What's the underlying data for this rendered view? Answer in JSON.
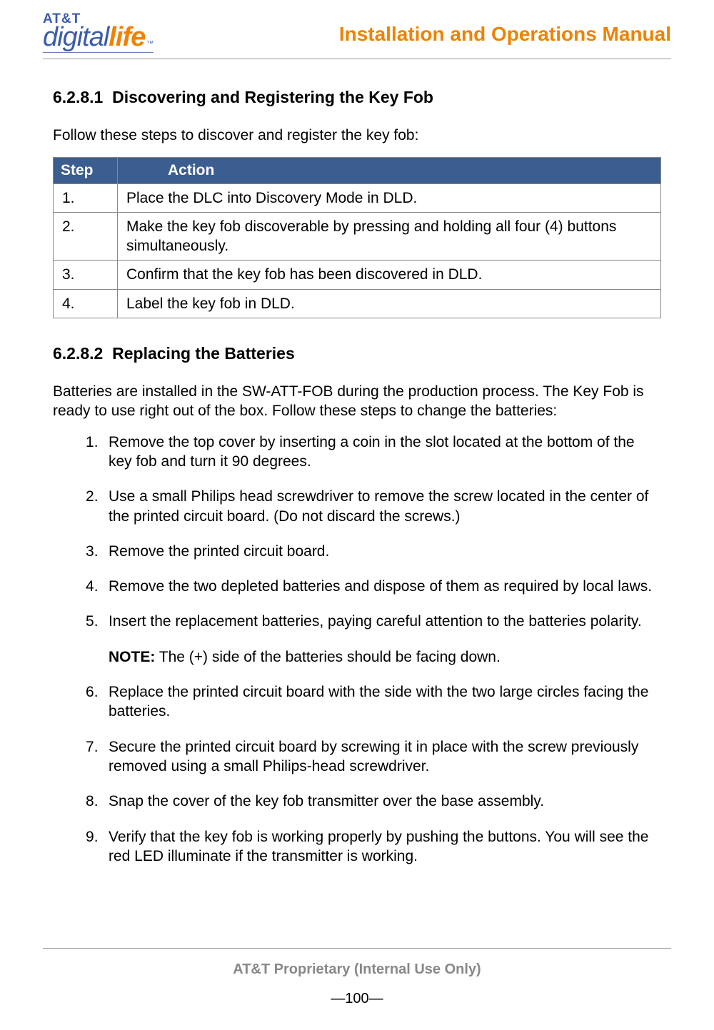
{
  "header": {
    "logo_top": "AT&T",
    "logo_left": "digital",
    "logo_right": "life",
    "logo_tm": "™",
    "doc_title": "Installation and Operations Manual"
  },
  "section1": {
    "number": "6.2.8.1",
    "title": "Discovering and Registering the Key Fob",
    "intro": "Follow these steps to discover and register the key fob:",
    "table": {
      "col_step": "Step",
      "col_action": "Action",
      "rows": [
        {
          "step": "1.",
          "action": "Place the DLC into Discovery Mode in DLD."
        },
        {
          "step": "2.",
          "action": "Make the key fob discoverable by pressing and holding all four (4) buttons simultaneously."
        },
        {
          "step": "3.",
          "action": "Confirm that the key fob has been discovered in DLD."
        },
        {
          "step": "4.",
          "action": "Label the key fob in DLD."
        }
      ]
    }
  },
  "section2": {
    "number": "6.2.8.2",
    "title": "Replacing the Batteries",
    "intro": "Batteries are installed in the SW-ATT-FOB during the production process. The Key Fob is ready to use right out of the box. Follow these steps to change the batteries:",
    "steps": [
      "Remove the top cover by inserting a coin in the slot located at the bottom of the key fob and turn it 90 degrees.",
      "Use a small Philips head screwdriver to remove the screw located in the center of the printed circuit board. (Do not discard the screws.)",
      "Remove the printed circuit board.",
      "Remove the two depleted batteries and dispose of them as required by local laws.",
      "Insert the replacement batteries, paying careful attention to the batteries polarity.",
      "Replace the printed circuit board with the side with the two large circles facing the batteries.",
      "Secure the printed circuit board by screwing it in place with the screw previously removed using a small Philips-head screwdriver.",
      "Snap the cover of the key fob transmitter over the base assembly.",
      "Verify that the key fob is working properly by pushing the buttons. You will see the red LED illuminate if the transmitter is working."
    ],
    "note_label": "NOTE:",
    "note_text": " The (+) side of the batteries should be facing down."
  },
  "footer": {
    "proprietary": "AT&T Proprietary (Internal Use Only)",
    "page": "—100—"
  }
}
